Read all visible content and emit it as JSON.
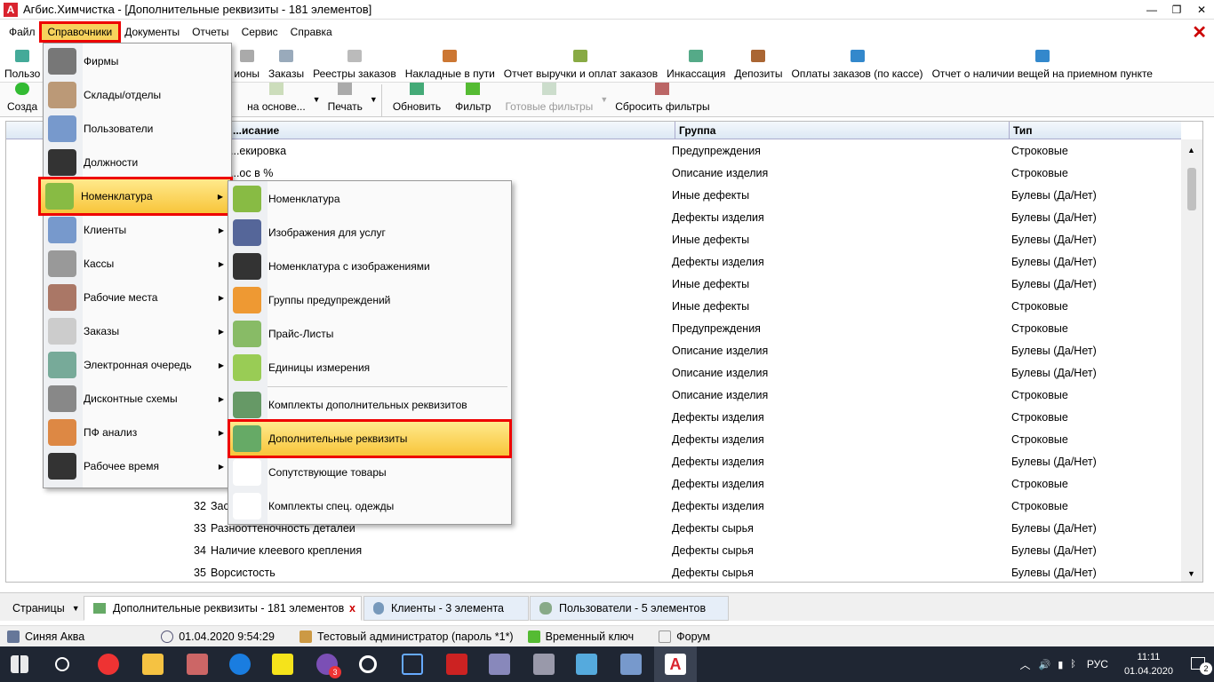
{
  "window": {
    "title": "Агбис.Химчистка - [Дополнительные реквизиты - 181 элементов]",
    "min": "—",
    "max": "❐",
    "close": "✕"
  },
  "menubar": [
    "Файл",
    "Справочники",
    "Документы",
    "Отчеты",
    "Сервис",
    "Справка"
  ],
  "toolbar1": [
    "Пользо",
    "ионы",
    "Заказы",
    "Реестры заказов",
    "Накладные в пути",
    "Отчет выручки и оплат заказов",
    "Инкассация",
    "Депозиты",
    "Оплаты заказов (по кассе)",
    "Отчет о наличии вещей на приемном пункте"
  ],
  "toolbar2": {
    "create": "Созда",
    "based_on": "на основе...",
    "print": "Печать",
    "refresh": "Обновить",
    "filter": "Фильтр",
    "ready_filters": "Готовые фильтры",
    "reset_filters": "Сбросить фильтры"
  },
  "grid": {
    "headers": [
      "...исание",
      "Группа",
      "Тип"
    ],
    "rows": [
      {
        "num": "",
        "name": "...екировка",
        "group": "Предупреждения",
        "type": "Строковые"
      },
      {
        "num": "",
        "name": "...ос в %",
        "group": "Описание изделия",
        "type": "Строковые"
      },
      {
        "num": "",
        "name": "",
        "group": "Иные дефекты",
        "type": "Булевы (Да/Нет)"
      },
      {
        "num": "",
        "name": "",
        "group": "Дефекты изделия",
        "type": "Булевы (Да/Нет)"
      },
      {
        "num": "",
        "name": "",
        "group": "Иные дефекты",
        "type": "Булевы (Да/Нет)"
      },
      {
        "num": "",
        "name": "",
        "group": "Дефекты изделия",
        "type": "Булевы (Да/Нет)"
      },
      {
        "num": "",
        "name": "",
        "group": "Иные дефекты",
        "type": "Булевы (Да/Нет)"
      },
      {
        "num": "",
        "name": "",
        "group": "Иные дефекты",
        "type": "Строковые"
      },
      {
        "num": "",
        "name": "",
        "group": "Предупреждения",
        "type": "Строковые"
      },
      {
        "num": "",
        "name": "",
        "group": "Описание изделия",
        "type": "Булевы (Да/Нет)"
      },
      {
        "num": "",
        "name": "",
        "group": "Описание изделия",
        "type": "Булевы (Да/Нет)"
      },
      {
        "num": "",
        "name": "",
        "group": "Описание изделия",
        "type": "Строковые"
      },
      {
        "num": "",
        "name": "",
        "group": "Дефекты изделия",
        "type": "Строковые"
      },
      {
        "num": "",
        "name": "",
        "group": "Дефекты изделия",
        "type": "Строковые"
      },
      {
        "num": "",
        "name": "",
        "group": "Дефекты изделия",
        "type": "Булевы (Да/Нет)"
      },
      {
        "num": "",
        "name": "",
        "group": "Дефекты изделия",
        "type": "Строковые"
      },
      {
        "num": "32",
        "name": "Зас",
        "group": "Дефекты изделия",
        "type": "Строковые"
      },
      {
        "num": "33",
        "name": "Разнооттеночность деталей",
        "group": "Дефекты сырья",
        "type": "Булевы (Да/Нет)"
      },
      {
        "num": "34",
        "name": "Наличие клеевого крепления",
        "group": "Дефекты сырья",
        "type": "Булевы (Да/Нет)"
      },
      {
        "num": "35",
        "name": "Ворсистость",
        "group": "Дефекты сырья",
        "type": "Булевы (Да/Нет)"
      }
    ]
  },
  "menu1": [
    "Фирмы",
    "Склады/отделы",
    "Пользователи",
    "Должности",
    "Номенклатура",
    "Клиенты",
    "Кассы",
    "Рабочие места",
    "Заказы",
    "Электронная очередь",
    "Дисконтные схемы",
    "ПФ анализ",
    "Рабочее время"
  ],
  "menu1_arrows": [
    false,
    false,
    false,
    false,
    true,
    true,
    true,
    true,
    true,
    true,
    true,
    true,
    true
  ],
  "menu2": [
    "Номенклатура",
    "Изображения для услуг",
    "Номенклатура с изображениями",
    "Группы предупреждений",
    "Прайс-Листы",
    "Единицы измерения",
    "Комплекты дополнительных реквизитов",
    "Дополнительные реквизиты",
    "Сопутствующие товары",
    "Комплекты спец. одежды"
  ],
  "tabs": {
    "pages": "Страницы",
    "tab1": "Дополнительные реквизиты - 181 элементов",
    "tab1_close": "x",
    "tab2": "Клиенты - 3 элемента",
    "tab3": "Пользователи - 5 элементов"
  },
  "status": {
    "org": "Синяя Аква",
    "datetime": "01.04.2020 9:54:29",
    "user": "Тестовый администратор (пароль *1*)",
    "key": "Временный ключ",
    "forum": "Форум"
  },
  "taskbar": {
    "lang": "РУС",
    "time": "11:11",
    "date": "01.04.2020",
    "notif": "2",
    "badge": "3"
  }
}
